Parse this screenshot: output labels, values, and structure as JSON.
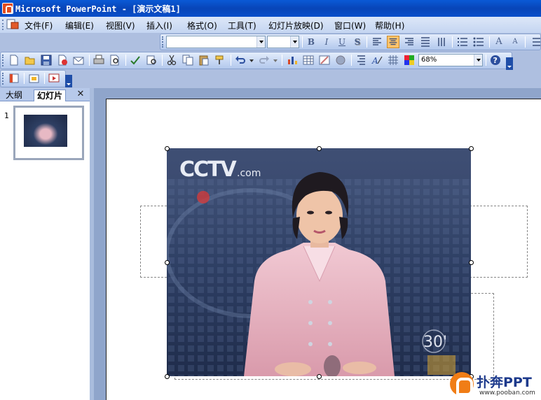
{
  "window": {
    "title": "Microsoft PowerPoint - [演示文稿1]"
  },
  "menubar": {
    "items": [
      {
        "label": "文件(F)"
      },
      {
        "label": "编辑(E)"
      },
      {
        "label": "视图(V)"
      },
      {
        "label": "插入(I)"
      },
      {
        "label": "格式(O)"
      },
      {
        "label": "工具(T)"
      },
      {
        "label": "幻灯片放映(D)"
      },
      {
        "label": "窗口(W)"
      },
      {
        "label": "帮助(H)"
      }
    ]
  },
  "formatting_toolbar": {
    "font_name": "",
    "font_size": "",
    "bold": "B",
    "italic": "I",
    "underline": "U",
    "shadow": "S",
    "increase_font": "A",
    "decrease_font": "A"
  },
  "standard_toolbar": {
    "zoom": "68%"
  },
  "left_pane": {
    "tabs": [
      {
        "label": "大纲"
      },
      {
        "label": "幻灯片"
      }
    ],
    "close": "✕",
    "slides": [
      {
        "number": "1"
      }
    ]
  },
  "slide": {
    "picture": {
      "logo_text": "CCTV",
      "logo_suffix": ".com",
      "corner_text": "30'"
    }
  },
  "watermark": {
    "brand": "扑奔PPT",
    "url": "www.pooban.com",
    "logo_color": "#f07d16"
  }
}
